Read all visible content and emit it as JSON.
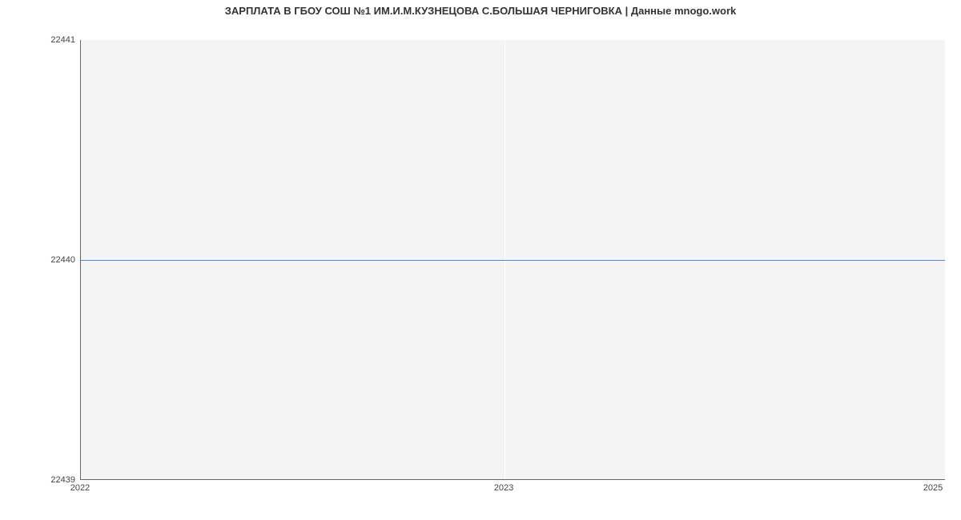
{
  "chart_data": {
    "type": "line",
    "title": "ЗАРПЛАТА В ГБОУ СОШ №1 ИМ.И.М.КУЗНЕЦОВА С.БОЛЬШАЯ ЧЕРНИГОВКА | Данные mnogo.work",
    "xlabel": "",
    "ylabel": "",
    "x": [
      2022,
      2023,
      2025
    ],
    "values": [
      22440,
      22440,
      22440
    ],
    "x_ticks": [
      2022,
      2023,
      2025
    ],
    "y_ticks": [
      22439,
      22440,
      22441
    ],
    "ylim": [
      22439,
      22441
    ],
    "xlim": [
      2022,
      2025
    ],
    "grid_v": true,
    "line_color": "#4a86e8"
  },
  "axis": {
    "y0": "22439",
    "y1": "22440",
    "y2": "22441",
    "x0": "2022",
    "x1": "2023",
    "x2": "2025"
  }
}
